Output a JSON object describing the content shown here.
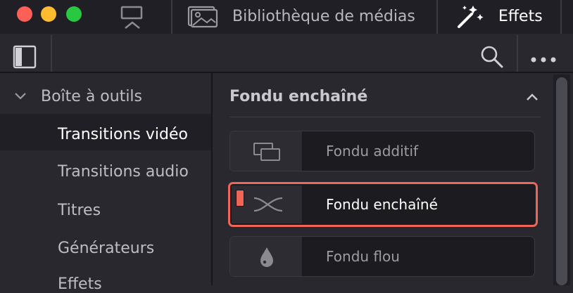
{
  "titlebar": {
    "media_library_label": "Bibliothèque de médias",
    "effects_label": "Effets"
  },
  "sidebar": {
    "group_label": "Boîte à outils",
    "items": [
      {
        "label": "Transitions vidéo",
        "selected": true
      },
      {
        "label": "Transitions audio",
        "selected": false
      },
      {
        "label": "Titres",
        "selected": false
      },
      {
        "label": "Générateurs",
        "selected": false
      },
      {
        "label": "Effets",
        "selected": false
      }
    ]
  },
  "main": {
    "section_title": "Fondu enchaîné",
    "effects": [
      {
        "label": "Fondu additif",
        "icon": "additive-dissolve-icon",
        "selected": false
      },
      {
        "label": "Fondu enchaîné",
        "icon": "cross-dissolve-icon",
        "selected": true
      },
      {
        "label": "Fondu flou",
        "icon": "blur-dissolve-icon",
        "selected": false
      }
    ]
  },
  "colors": {
    "accent": "#ef6658",
    "background": "#28282e",
    "titlebar": "#1f1f25"
  }
}
